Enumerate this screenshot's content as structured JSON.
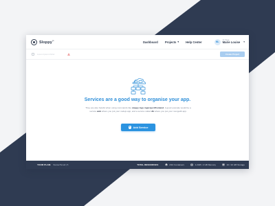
{
  "brand": {
    "name": "Sloppy",
    "suffix": "io"
  },
  "nav": {
    "items": [
      {
        "label": "Dashboard"
      },
      {
        "label": "Projects"
      },
      {
        "label": "Help Center"
      }
    ],
    "user": {
      "greeting": "Hi there,",
      "name": "Marie Louise",
      "initials": "ML"
    }
  },
  "toolbar": {
    "project_name": "Lorem Ipsum Dolor",
    "create_label": "Create Project"
  },
  "empty_state": {
    "headline": "Services are a good way to organise your app.",
    "desc_1": "They are also helpful when using commands like ",
    "desc_cmd": "sloppy logs myproject/frontend",
    "desc_2": ". A good example would be a service ",
    "desc_web": "web",
    "desc_3": " where you put your nodejs app, and a service called ",
    "desc_db": "db",
    "desc_4": " where you put your mongodb app.",
    "button_label": "Add Service"
  },
  "footer": {
    "plan_label": "YOUR PLAN:",
    "plan_value": "Starter/Small | 5",
    "resources_label": "TOTAL RESOURCES:",
    "containers": "2/10 Containers",
    "memory": "1.2GB / 2 GB Memory",
    "storage": "10 / 16 GB Storage"
  },
  "colors": {
    "accent": "#2b93e0",
    "navy": "#2f3b52",
    "background": "#f3f4f6"
  }
}
